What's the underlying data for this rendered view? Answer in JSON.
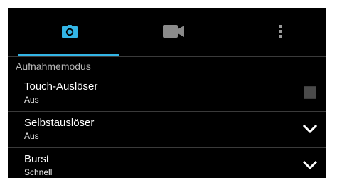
{
  "colors": {
    "accent": "#33b5e5",
    "video_icon": "#8a8a8a",
    "more_icon": "#9a9a9a",
    "background": "#000000",
    "divider": "#3a3a3a",
    "section_text": "#b7b7b7",
    "checkbox_fill": "#4a4a4a"
  },
  "tabs": [
    {
      "icon": "camera-icon",
      "selected": true
    },
    {
      "icon": "video-camera-icon",
      "selected": false
    },
    {
      "icon": "more-vertical-icon",
      "selected": false
    }
  ],
  "section": {
    "title": "Aufnahmemodus"
  },
  "settings": [
    {
      "title": "Touch-Auslöser",
      "value": "Aus",
      "control": "checkbox",
      "checked": false
    },
    {
      "title": "Selbstauslöser",
      "value": "Aus",
      "control": "dropdown"
    },
    {
      "title": "Burst",
      "value": "Schnell",
      "control": "dropdown"
    }
  ]
}
